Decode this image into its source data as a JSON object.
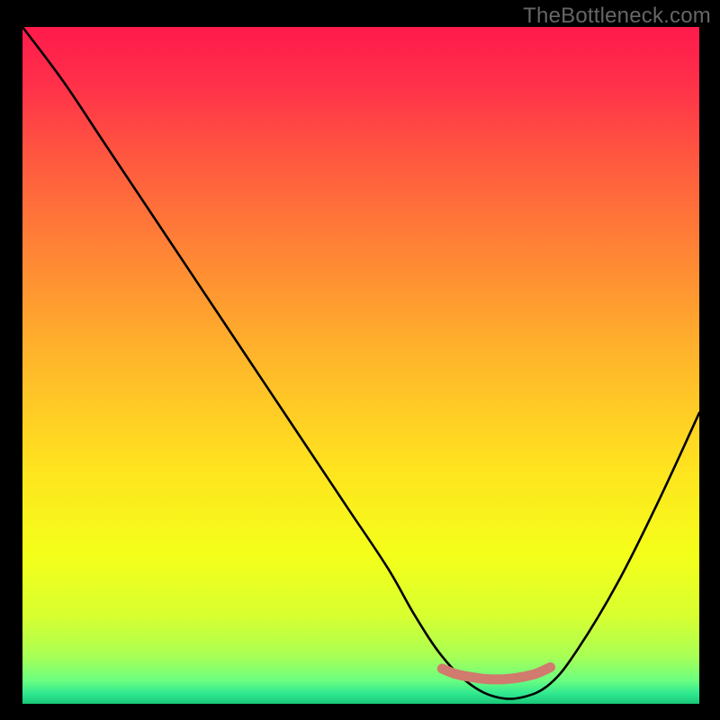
{
  "watermark": "TheBottleneck.com",
  "chart_data": {
    "type": "line",
    "title": "",
    "xlabel": "",
    "ylabel": "",
    "xlim": [
      0,
      100
    ],
    "ylim": [
      0,
      100
    ],
    "series": [
      {
        "name": "bottleneck-curve",
        "x": [
          0,
          6,
          12,
          18,
          24,
          30,
          36,
          42,
          48,
          54,
          58,
          62,
          66,
          70,
          74,
          78,
          82,
          88,
          94,
          100
        ],
        "values": [
          100,
          92,
          83,
          74,
          65,
          56,
          47,
          38,
          29,
          20,
          13,
          7,
          3,
          1,
          1,
          3,
          8,
          18,
          30,
          43
        ]
      },
      {
        "name": "sweet-spot-marker",
        "x": [
          62,
          64,
          66,
          68,
          70,
          72,
          74,
          76,
          78
        ],
        "values": [
          5.2,
          4.4,
          4.0,
          3.7,
          3.6,
          3.7,
          4.0,
          4.5,
          5.4
        ]
      }
    ],
    "gradient_stops": [
      {
        "offset": 0.0,
        "color": "#ff1a4b"
      },
      {
        "offset": 0.08,
        "color": "#ff2f4a"
      },
      {
        "offset": 0.2,
        "color": "#ff5a3f"
      },
      {
        "offset": 0.35,
        "color": "#ff8a34"
      },
      {
        "offset": 0.5,
        "color": "#ffb92a"
      },
      {
        "offset": 0.65,
        "color": "#ffe31f"
      },
      {
        "offset": 0.78,
        "color": "#f4ff1a"
      },
      {
        "offset": 0.87,
        "color": "#d8ff30"
      },
      {
        "offset": 0.93,
        "color": "#a8ff55"
      },
      {
        "offset": 0.965,
        "color": "#6cff80"
      },
      {
        "offset": 0.985,
        "color": "#30e890"
      },
      {
        "offset": 1.0,
        "color": "#18c878"
      }
    ],
    "marker_color": "#d17a6e"
  }
}
